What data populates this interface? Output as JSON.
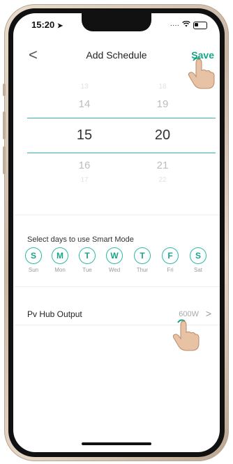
{
  "status_bar": {
    "time": "15:20",
    "location_arrow": "location-arrow-icon"
  },
  "header": {
    "back": "<",
    "title": "Add Schedule",
    "save": "Save"
  },
  "time_picker": {
    "hours": [
      "13",
      "14",
      "15",
      "16",
      "17"
    ],
    "minutes": [
      "18",
      "19",
      "20",
      "21",
      "22"
    ],
    "selected_hour": "15",
    "selected_minute": "20"
  },
  "days": {
    "label": "Select days to use Smart Mode",
    "items": [
      {
        "letter": "S",
        "name": "Sun"
      },
      {
        "letter": "M",
        "name": "Mon"
      },
      {
        "letter": "T",
        "name": "Tue"
      },
      {
        "letter": "W",
        "name": "Wed"
      },
      {
        "letter": "T",
        "name": "Thur"
      },
      {
        "letter": "F",
        "name": "Fri"
      },
      {
        "letter": "S",
        "name": "Sat"
      }
    ]
  },
  "pv_output": {
    "label": "Pv Hub Output",
    "value": "600W",
    "chevron": ">"
  },
  "colors": {
    "accent": "#17a589",
    "line": "#2bb8a8",
    "frame": "#c9b7a4"
  }
}
